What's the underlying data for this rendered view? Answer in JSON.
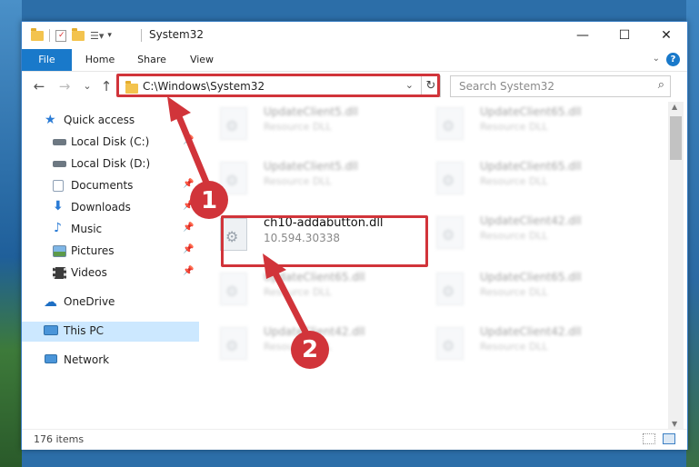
{
  "window": {
    "title": "System32",
    "minimize": "—",
    "maximize": "☐",
    "close": "✕"
  },
  "ribbon": {
    "tabs": [
      "File",
      "Home",
      "Share",
      "View"
    ],
    "help": "?",
    "collapse": "⌄"
  },
  "nav_buttons": {
    "back": "←",
    "forward": "→",
    "recent": "⌄",
    "up": "↑"
  },
  "address": {
    "path": "C:\\Windows\\System32",
    "dropdown": "⌄",
    "refresh": "↻"
  },
  "search": {
    "placeholder": "Search System32",
    "icon": "search-icon"
  },
  "sidebar": {
    "items": [
      {
        "label": "Quick access",
        "icon": "star-icon",
        "pinned": false
      },
      {
        "label": "Local Disk (C:)",
        "icon": "drive-icon",
        "pinned": true
      },
      {
        "label": "Local Disk (D:)",
        "icon": "drive-icon",
        "pinned": false
      },
      {
        "label": "Documents",
        "icon": "documents-icon",
        "pinned": true
      },
      {
        "label": "Downloads",
        "icon": "download-icon",
        "pinned": true
      },
      {
        "label": "Music",
        "icon": "music-icon",
        "pinned": true
      },
      {
        "label": "Pictures",
        "icon": "pictures-icon",
        "pinned": true
      },
      {
        "label": "Videos",
        "icon": "videos-icon",
        "pinned": true
      },
      {
        "label": "OneDrive",
        "icon": "cloud-icon",
        "pinned": false
      },
      {
        "label": "This PC",
        "icon": "pc-icon",
        "pinned": false,
        "selected": true
      },
      {
        "label": "Network",
        "icon": "network-icon",
        "pinned": false
      }
    ]
  },
  "files": {
    "left": [
      {
        "name": "UpdateClient5.dll",
        "type": "Resource DLL",
        "blurred": true
      },
      {
        "name": "UpdateClient5.dll",
        "type": "Resource DLL",
        "blurred": true
      },
      {
        "name": "ch10-addabutton.dll",
        "type": "10.594.30338",
        "blurred": false
      },
      {
        "name": "UpdateClient65.dll",
        "type": "Resource DLL",
        "blurred": true
      },
      {
        "name": "UpdateClient42.dll",
        "type": "Resource DLL",
        "blurred": true
      }
    ],
    "right": [
      {
        "name": "UpdateClient65.dll",
        "type": "Resource DLL",
        "blurred": true
      },
      {
        "name": "UpdateClient65.dll",
        "type": "Resource DLL",
        "blurred": true
      },
      {
        "name": "UpdateClient42.dll",
        "type": "Resource DLL",
        "blurred": true
      },
      {
        "name": "UpdateClient65.dll",
        "type": "Resource DLL",
        "blurred": true
      },
      {
        "name": "UpdateClient42.dll",
        "type": "Resource DLL",
        "blurred": true
      }
    ]
  },
  "status": {
    "count": "176 items"
  },
  "annotations": {
    "step1": "1",
    "step2": "2"
  },
  "colors": {
    "accent": "#1979ca",
    "highlight": "#d1343a",
    "selection": "#cce8ff"
  }
}
